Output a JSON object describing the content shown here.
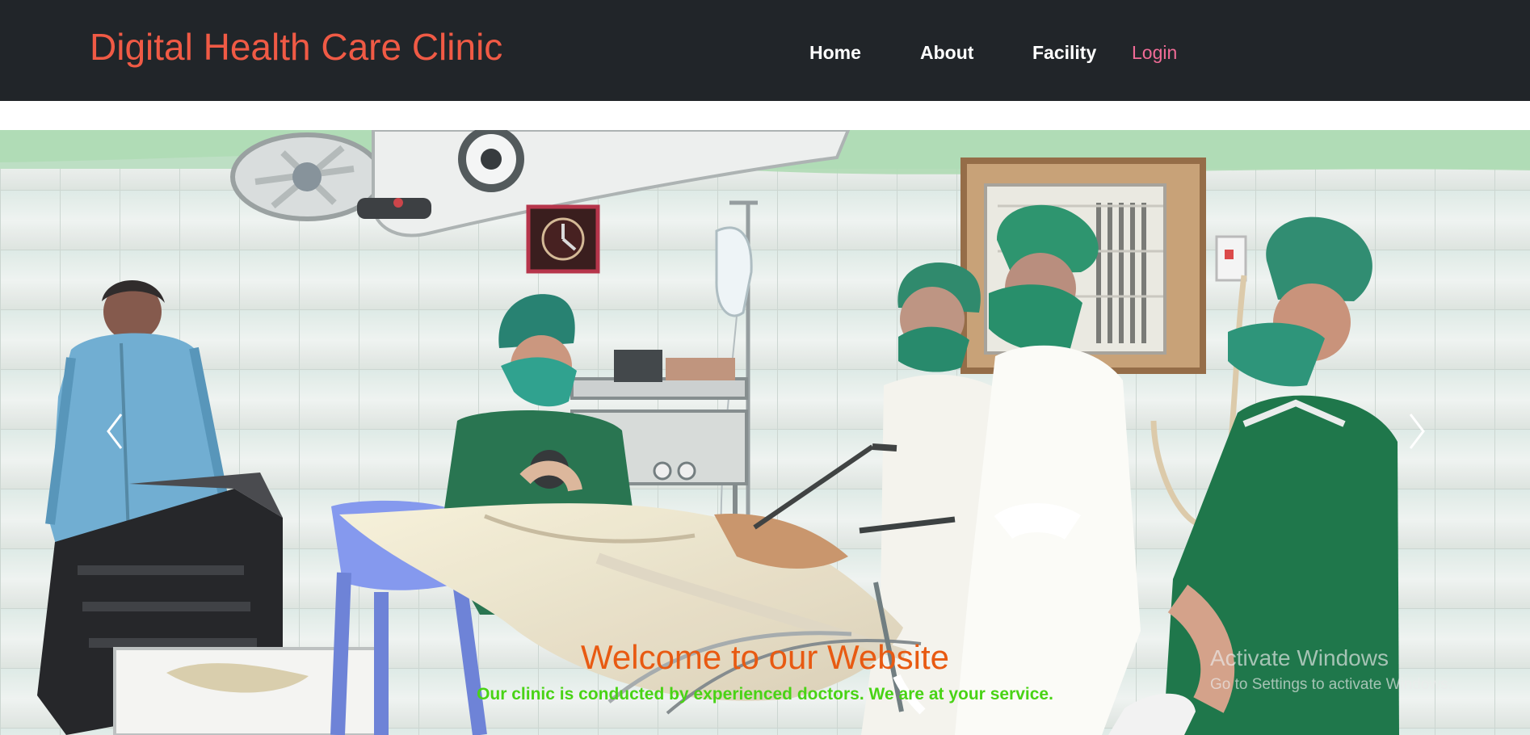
{
  "header": {
    "brand": "Digital Health Care Clinic",
    "nav": {
      "home": "Home",
      "about": "About",
      "facility": "Facility",
      "login": "Login"
    }
  },
  "carousel": {
    "caption_title": "Welcome to our Website",
    "caption_subtitle": "Our clinic is conducted by experienced doctors. We are at your service.",
    "previous_icon": "chevron-left-icon",
    "next_icon": "chevron-right-icon"
  },
  "watermark": {
    "title": "Activate Windows",
    "subtitle": "Go to Settings to activate Windows."
  },
  "colors": {
    "navbar": "#212529",
    "brand": "#f05a45",
    "login": "#f06b96",
    "caption_title": "#e85a12",
    "caption_subtitle": "#49d315"
  }
}
